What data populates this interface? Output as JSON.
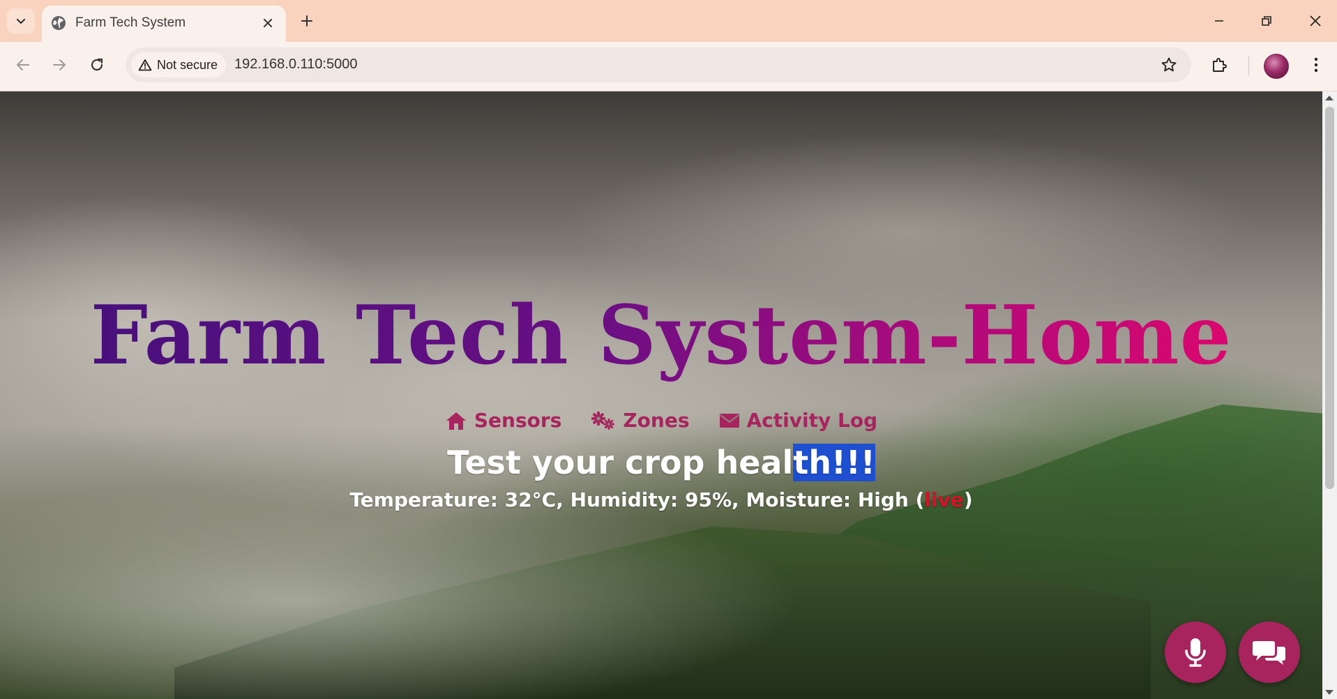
{
  "browser": {
    "tab": {
      "title": "Farm Tech System",
      "favicon": "globe-icon"
    },
    "security_label": "Not secure",
    "url": "192.168.0.110:5000",
    "toolbar_icons": [
      "back-arrow-icon",
      "forward-arrow-icon",
      "reload-icon",
      "warning-triangle-icon",
      "star-icon",
      "extensions-puzzle-icon",
      "kebab-menu-icon"
    ],
    "window_controls": [
      "minimize-icon",
      "restore-icon",
      "close-icon"
    ]
  },
  "page": {
    "title": "Farm Tech System-Home",
    "nav": [
      {
        "label": "Sensors",
        "icon": "home-icon"
      },
      {
        "label": "Zones",
        "icon": "cogs-icon"
      },
      {
        "label": "Activity Log",
        "icon": "envelope-icon"
      }
    ],
    "tagline": {
      "plain": "Test your crop heal",
      "selected": "th!!!"
    },
    "readings": {
      "text": "Temperature: 32°C, Humidity: 95%, Moisture: High (",
      "live": "live",
      "close": ")"
    },
    "fabs": [
      {
        "icon": "microphone-icon"
      },
      {
        "icon": "chat-bubbles-icon"
      }
    ],
    "colors": {
      "accent": "#a8245f",
      "title_start": "#42107a",
      "title_end": "#e8066c",
      "live": "#d4122a",
      "selection": "#1e4fd1"
    }
  }
}
